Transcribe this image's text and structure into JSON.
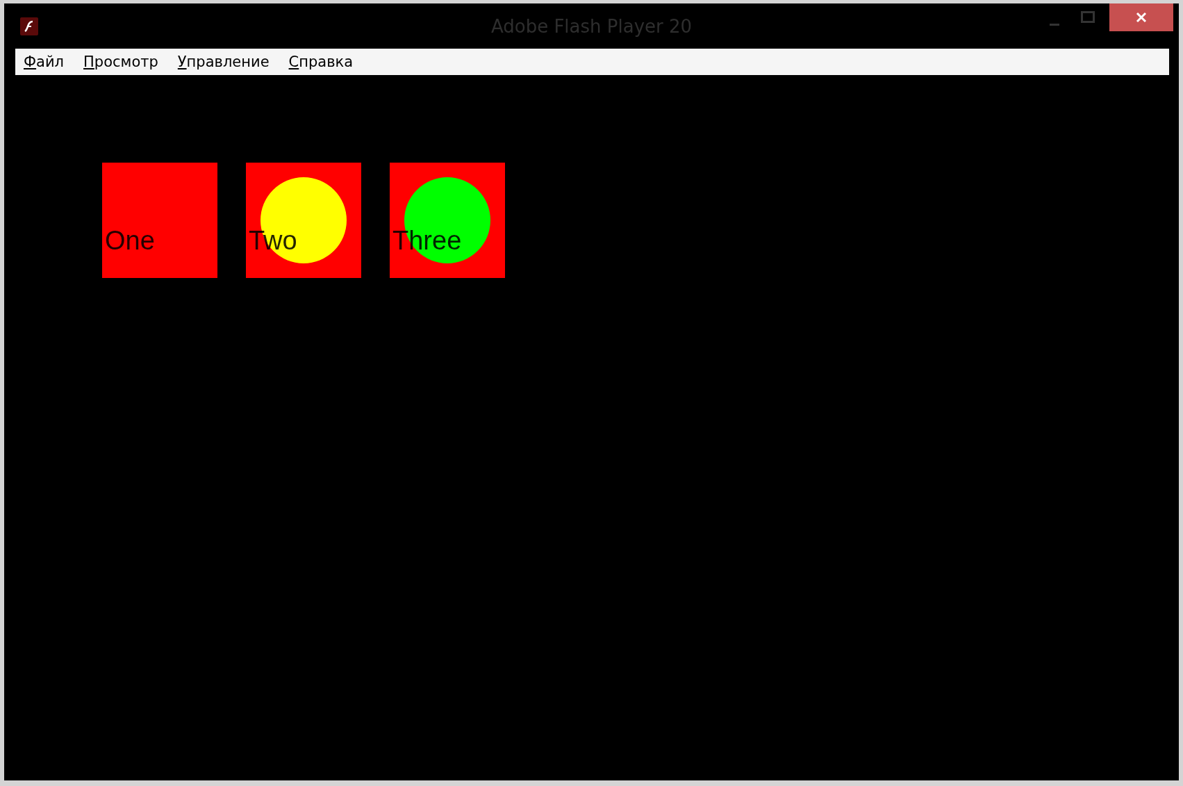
{
  "window": {
    "title": "Adobe Flash Player 20"
  },
  "menu": [
    {
      "label": "Файл"
    },
    {
      "label": "Просмотр"
    },
    {
      "label": "Управление"
    },
    {
      "label": "Справка"
    }
  ],
  "stage": {
    "items": [
      {
        "kind": "plain",
        "label": "One"
      },
      {
        "kind": "circle",
        "label": "Two",
        "color": "#ffff00"
      },
      {
        "kind": "circle",
        "label": "Three",
        "color": "#00ff00"
      }
    ]
  }
}
